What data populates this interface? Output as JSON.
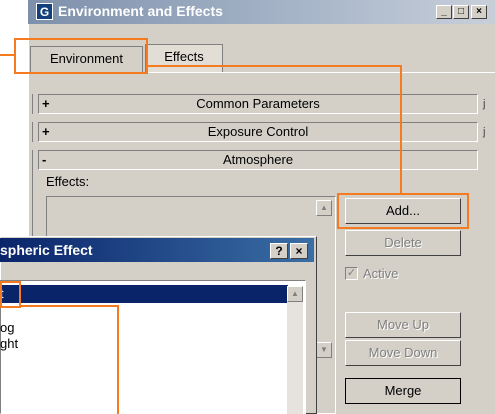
{
  "window": {
    "title": "Environment and Effects",
    "icon_glyph": "G",
    "caption_buttons": [
      "_",
      "□",
      "×"
    ]
  },
  "tabs": [
    {
      "label": "Environment"
    },
    {
      "label": "Effects"
    }
  ],
  "rollouts": [
    {
      "toggle": "+",
      "label": "Common Parameters"
    },
    {
      "toggle": "+",
      "label": "Exposure Control"
    },
    {
      "toggle": "-",
      "label": "Atmosphere"
    }
  ],
  "atmosphere": {
    "effects_label": "Effects:",
    "buttons": {
      "add": "Add...",
      "delete": "Delete",
      "move_up": "Move Up",
      "move_down": "Move Down",
      "merge": "Merge"
    },
    "active_label": "Active",
    "active_checked": true
  },
  "dialog": {
    "title": "spheric Effect",
    "help_glyph": "?",
    "close_glyph": "×",
    "items": [
      {
        "label": "t",
        "selected": true
      },
      {
        "label": "og",
        "selected": false
      },
      {
        "label": "ght",
        "selected": false
      }
    ]
  },
  "annotation_color": "#f47b20",
  "misc": {
    "right_edge_glyph": "j"
  }
}
